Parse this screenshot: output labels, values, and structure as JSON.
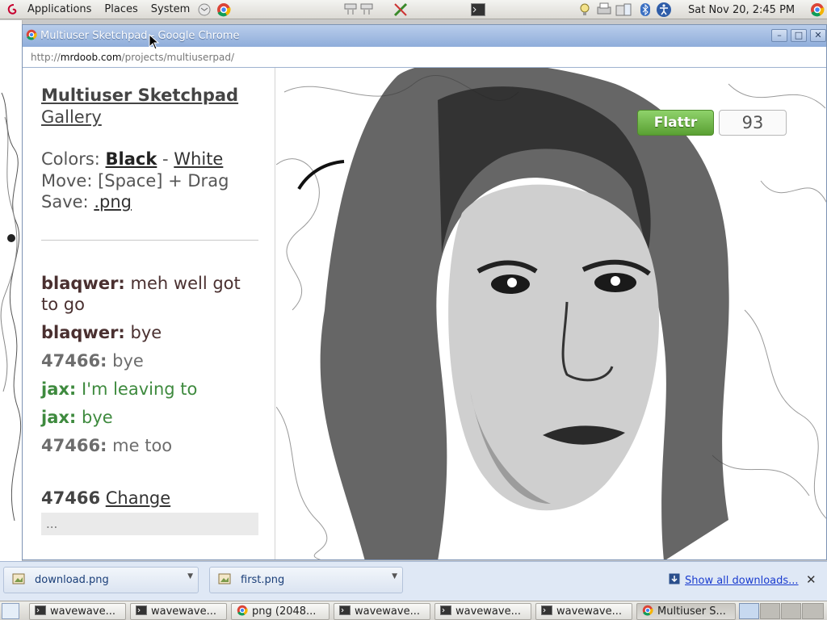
{
  "panel": {
    "menus": [
      "Applications",
      "Places",
      "System"
    ],
    "clock": "Sat Nov 20,  2:45 PM"
  },
  "window": {
    "title": "Multiuser Sketchpad - Google Chrome",
    "url_scheme": "http://",
    "url_host": "mrdoob.com",
    "url_path": "/projects/multiuserpad/",
    "buttons": {
      "minimize": "–",
      "maximize": "□",
      "close": "✕"
    }
  },
  "page": {
    "title": "Multiuser Sketchpad",
    "gallery": "Gallery",
    "colors_label": "Colors:",
    "color_black": "Black",
    "color_sep": "-",
    "color_white": "White",
    "move_text": "Move: [Space] + Drag",
    "save_label": "Save:",
    "save_link": ".png",
    "chat": [
      {
        "user": "blaqwer:",
        "text": "meh well got to go",
        "color": "#4a3030"
      },
      {
        "user": "blaqwer:",
        "text": "bye",
        "color": "#4a3030"
      },
      {
        "user": "47466:",
        "text": "bye",
        "color": "#6d6d6d"
      },
      {
        "user": "jax:",
        "text": "I'm leaving to",
        "color": "#3e8a3e"
      },
      {
        "user": "jax:",
        "text": "bye",
        "color": "#3e8a3e"
      },
      {
        "user": "47466:",
        "text": "me too",
        "color": "#6d6d6d"
      }
    ],
    "username": "47466",
    "change_link": "Change",
    "input_placeholder": "..."
  },
  "flattr": {
    "label": "Flattr",
    "count": "93"
  },
  "downloads": {
    "items": [
      "download.png",
      "first.png"
    ],
    "show_all": "Show all downloads...",
    "close": "✕"
  },
  "taskbar": {
    "items": [
      {
        "label": "wavewave...",
        "icon": "terminal-icon"
      },
      {
        "label": "wavewave...",
        "icon": "terminal-icon"
      },
      {
        "label": "png (2048...",
        "icon": "chrome-icon"
      },
      {
        "label": "wavewave...",
        "icon": "terminal-icon"
      },
      {
        "label": "wavewave...",
        "icon": "terminal-icon"
      },
      {
        "label": "wavewave...",
        "icon": "terminal-icon"
      },
      {
        "label": "Multiuser S...",
        "icon": "chrome-icon"
      }
    ]
  },
  "colors": {
    "accent": "#8fadda",
    "chat_green": "#3e8a3e",
    "flattr_green": "#5aa033"
  }
}
